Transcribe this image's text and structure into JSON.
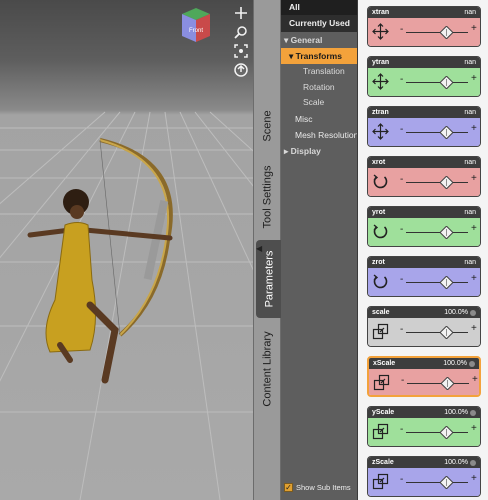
{
  "tabs": {
    "scene": "Scene",
    "tool_settings": "Tool Settings",
    "parameters": "Parameters",
    "content_library": "Content Library"
  },
  "tree": {
    "all": "All",
    "currently_used": "Currently Used",
    "general": "General",
    "transforms": "Transforms",
    "translation": "Translation",
    "rotation": "Rotation",
    "scale": "Scale",
    "misc": "Misc",
    "mesh_resolution": "Mesh Resolution",
    "display": "Display",
    "show_sub_items": "Show Sub Items"
  },
  "params": [
    {
      "label": "xtran",
      "value": "nan",
      "color": "red",
      "icon": "move-icon"
    },
    {
      "label": "ytran",
      "value": "nan",
      "color": "green",
      "icon": "move-icon"
    },
    {
      "label": "ztran",
      "value": "nan",
      "color": "blue",
      "icon": "move-icon"
    },
    {
      "label": "xrot",
      "value": "nan",
      "color": "red",
      "icon": "rotate-icon"
    },
    {
      "label": "yrot",
      "value": "nan",
      "color": "green",
      "icon": "rotate-icon"
    },
    {
      "label": "zrot",
      "value": "nan",
      "color": "blue",
      "icon": "rotate-icon"
    },
    {
      "label": "scale",
      "value": "100.0%",
      "color": "gray",
      "icon": "scale-icon"
    },
    {
      "label": "xScale",
      "value": "100.0%",
      "color": "red",
      "icon": "scale-icon"
    },
    {
      "label": "yScale",
      "value": "100.0%",
      "color": "green",
      "icon": "scale-icon"
    },
    {
      "label": "zScale",
      "value": "100.0%",
      "color": "blue",
      "icon": "scale-icon"
    }
  ],
  "colors": {
    "accent_orange": "#f3a23b",
    "red": "#e8a1a1",
    "green": "#9fe09b",
    "blue": "#a8a5ea",
    "gray": "#cfcfcf"
  }
}
